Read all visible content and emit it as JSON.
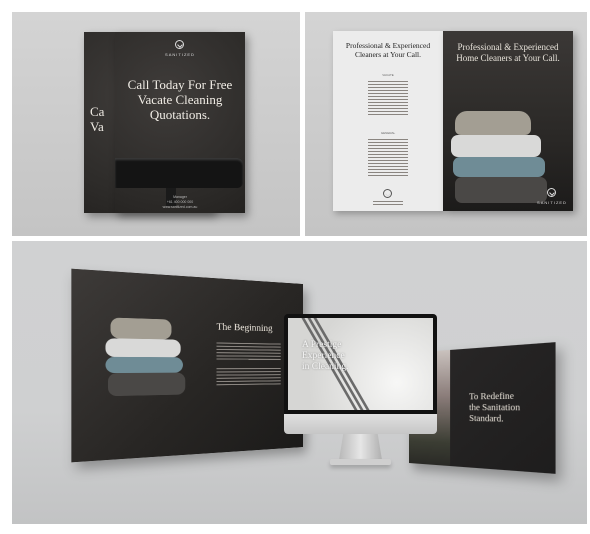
{
  "panel1": {
    "brand": "SANITIZED",
    "headline_lines": [
      "Call Today For Free",
      "Vacate Cleaning",
      "Quotations."
    ],
    "back_headline_lines": [
      "Ca",
      "Va"
    ],
    "contact_lines": [
      "Manager",
      "+61 400 000 000",
      "www.sanitized.com.au"
    ]
  },
  "panel2": {
    "left_title_lines": [
      "Professional & Experienced",
      "Cleaners at Your Call."
    ],
    "right_title_lines": [
      "Professional & Experienced",
      "Home Cleaners at Your Call."
    ],
    "brand": "SANITIZED",
    "section1": "VACATE",
    "section2": "GENERAL",
    "towel_colors": [
      "#a39e93",
      "#d9d9d8",
      "#6f8c96",
      "#4a4846"
    ]
  },
  "panel3": {
    "left_slide_title": "The Beginning",
    "center_slide_lines": [
      "A Prestige",
      "Experience",
      "in Cleaning."
    ],
    "right_slide_lines": [
      "To Redefine",
      "the Sanitation",
      "Standard."
    ]
  }
}
